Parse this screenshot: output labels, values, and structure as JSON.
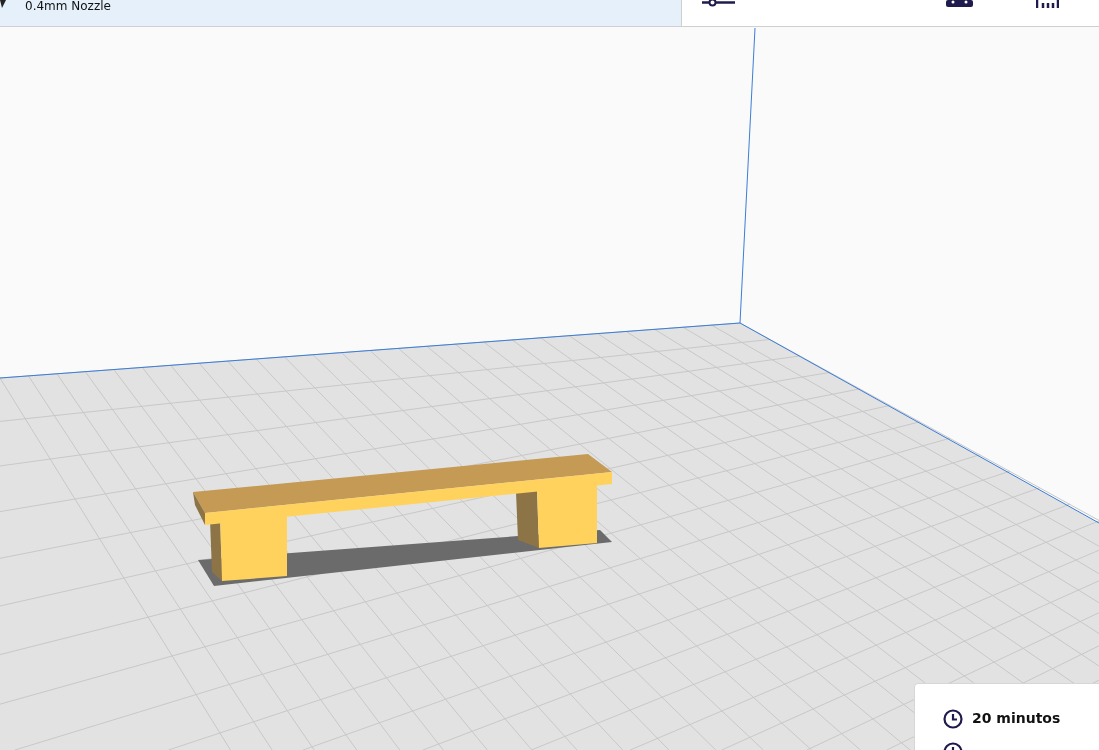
{
  "printer_bar": {
    "nozzle_label": "0.4mm Nozzle"
  },
  "print_summary": {
    "print_time": "20 minutos"
  }
}
